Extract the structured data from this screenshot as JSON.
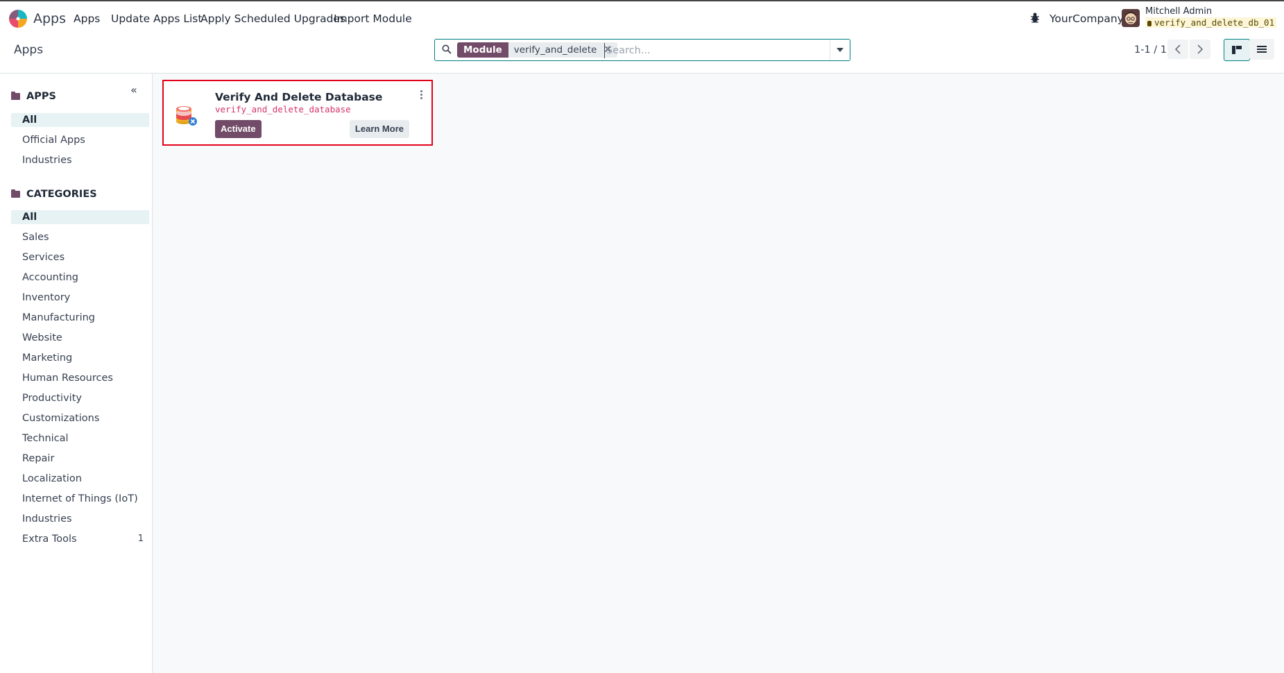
{
  "navbar": {
    "app_name": "Apps",
    "menu": [
      "Apps",
      "Update Apps List",
      "Apply Scheduled Upgrades",
      "Import Module"
    ],
    "company": "YourCompany",
    "user_name": "Mitchell Admin",
    "database": "verify_and_delete_db_01",
    "icons": {
      "logo": "odoo-logo-icon",
      "debug": "bug-icon",
      "avatar": "user-avatar"
    }
  },
  "control_panel": {
    "breadcrumb": "Apps",
    "search": {
      "facet_label": "Module",
      "facet_value": "verify_and_delete",
      "placeholder": "Search..."
    },
    "pager": "1-1 / 1"
  },
  "sidebar": {
    "apps_header": "APPS",
    "apps_items": [
      {
        "label": "All",
        "active": true
      },
      {
        "label": "Official Apps",
        "active": false
      },
      {
        "label": "Industries",
        "active": false
      }
    ],
    "categories_header": "CATEGORIES",
    "categories_items": [
      {
        "label": "All",
        "active": true,
        "count": ""
      },
      {
        "label": "Sales",
        "count": ""
      },
      {
        "label": "Services",
        "count": ""
      },
      {
        "label": "Accounting",
        "count": ""
      },
      {
        "label": "Inventory",
        "count": ""
      },
      {
        "label": "Manufacturing",
        "count": ""
      },
      {
        "label": "Website",
        "count": ""
      },
      {
        "label": "Marketing",
        "count": ""
      },
      {
        "label": "Human Resources",
        "count": ""
      },
      {
        "label": "Productivity",
        "count": ""
      },
      {
        "label": "Customizations",
        "count": ""
      },
      {
        "label": "Technical",
        "count": ""
      },
      {
        "label": "Repair",
        "count": ""
      },
      {
        "label": "Localization",
        "count": ""
      },
      {
        "label": "Internet of Things (IoT)",
        "count": ""
      },
      {
        "label": "Industries",
        "count": ""
      },
      {
        "label": "Extra Tools",
        "count": "1"
      }
    ]
  },
  "module_card": {
    "title": "Verify And Delete Database",
    "technical_name": "verify_and_delete_database",
    "activate_label": "Activate",
    "learn_more_label": "Learn More"
  },
  "colors": {
    "accent": "#714b67",
    "teal": "#017e84",
    "highlight_border": "#e3001b"
  }
}
